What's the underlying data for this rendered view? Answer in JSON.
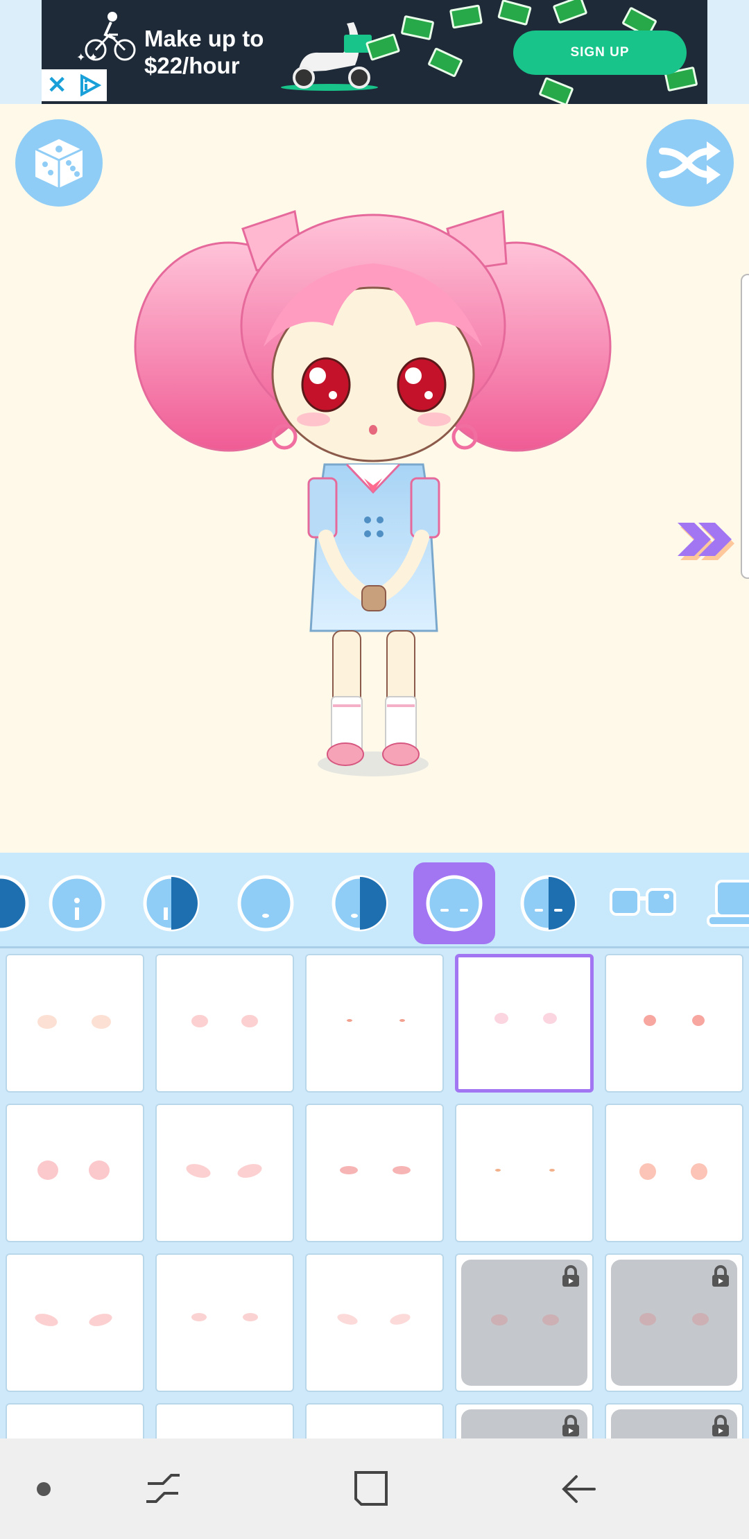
{
  "ad": {
    "headline_line1": "Make up to",
    "headline_line2": "$22/hour",
    "cta_label": "SIGN UP"
  },
  "canvas": {
    "random_button_icon": "dice-icon",
    "shuffle_button_icon": "shuffle-icon",
    "next_icon": "double-chevron-right-icon"
  },
  "categories": [
    {
      "icon": "face-partial-icon",
      "selected": false
    },
    {
      "icon": "face-eye-icon",
      "selected": false
    },
    {
      "icon": "face-half-eye-icon",
      "selected": false
    },
    {
      "icon": "face-mouth-icon",
      "selected": false
    },
    {
      "icon": "face-half-mouth-icon",
      "selected": false
    },
    {
      "icon": "face-blush-icon",
      "selected": true
    },
    {
      "icon": "face-half-blush-icon",
      "selected": false
    },
    {
      "icon": "glasses-icon",
      "selected": false
    },
    {
      "icon": "computer-icon",
      "selected": false
    }
  ],
  "items": [
    {
      "style": "soft-peach",
      "selected": false,
      "locked": false
    },
    {
      "style": "soft-pink",
      "selected": false,
      "locked": false
    },
    {
      "style": "tiny-marks",
      "selected": false,
      "locked": false
    },
    {
      "style": "faint-pink",
      "selected": true,
      "locked": false
    },
    {
      "style": "dot-red",
      "selected": false,
      "locked": false
    },
    {
      "style": "big-pink",
      "selected": false,
      "locked": false
    },
    {
      "style": "wide-pink",
      "selected": false,
      "locked": false
    },
    {
      "style": "small-oval",
      "selected": false,
      "locked": false
    },
    {
      "style": "tiny-dot",
      "selected": false,
      "locked": false
    },
    {
      "style": "soft-orange",
      "selected": false,
      "locked": false
    },
    {
      "style": "angled-pink",
      "selected": false,
      "locked": false
    },
    {
      "style": "faint-small",
      "selected": false,
      "locked": false
    },
    {
      "style": "angled-light",
      "selected": false,
      "locked": false
    },
    {
      "style": "locked-1",
      "selected": false,
      "locked": true
    },
    {
      "style": "locked-2",
      "selected": false,
      "locked": true
    }
  ],
  "colors": {
    "accent": "#a276f2",
    "strip": "#c8e8fb",
    "button": "#8fcdf6",
    "canvas_bg": "#fff9ea"
  },
  "nav": {
    "dot_icon": "dot-icon",
    "recents_icon": "recents-icon",
    "home_icon": "home-icon",
    "back_icon": "back-arrow-icon"
  }
}
